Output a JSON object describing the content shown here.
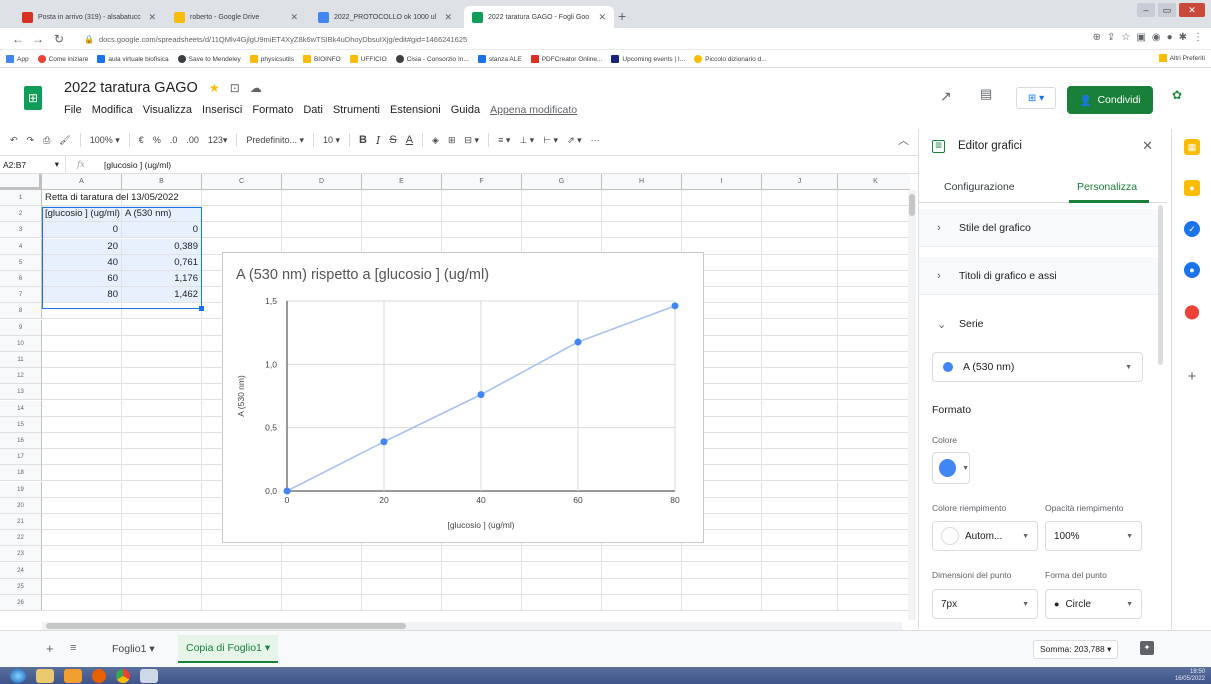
{
  "browser": {
    "tabs": [
      {
        "title": "Posta in arrivo (319) - alsabatucc",
        "color": "#d93025"
      },
      {
        "title": "roberto - Google Drive",
        "color": "#fbbc04"
      },
      {
        "title": "2022_PROTOCOLLO ok 1000 ul",
        "color": "#4285f4"
      },
      {
        "title": "2022 taratura GAGO - Fogli Goo",
        "color": "#0f9d58"
      }
    ],
    "url": "docs.google.com/spreadsheets/d/11QMlv4GjlgU9miET4XyZ8k6wTSIBk4uDhoyDbsuIXjg/edit#gid=1466241625",
    "bookmarks": [
      "App",
      "Come iniziare",
      "aula virtuale biofisica",
      "Save to Mendeley",
      "physicsutils",
      "BIOINFO",
      "UFFICIO",
      "Cisia - Consorzio In...",
      "stanza ALE",
      "PDFCreator Online...",
      "Upcoming events | I...",
      "Piccolo dizionario d..."
    ],
    "other_bookmarks": "Altri Preferiti"
  },
  "doc": {
    "title": "2022 taratura GAGO",
    "menus": [
      "File",
      "Modifica",
      "Visualizza",
      "Inserisci",
      "Formato",
      "Dati",
      "Strumenti",
      "Estensioni",
      "Guida"
    ],
    "saved_status": "Appena modificato",
    "share_label": "Condividi"
  },
  "toolbar": {
    "zoom": "100%",
    "currency": "€",
    "percent": "%",
    "dec_less": ".0",
    "dec_more": ".00",
    "format_more": "123",
    "font": "Predefinito...",
    "font_size": "10"
  },
  "formula_bar": {
    "name_box": "A2:B7",
    "fx": "fx",
    "content": "[glucosio ] (ug/ml)"
  },
  "grid": {
    "columns": [
      "A",
      "B",
      "C",
      "D",
      "E",
      "F",
      "G",
      "H",
      "I",
      "J",
      "K"
    ],
    "rows": [
      "1",
      "2",
      "3",
      "4",
      "5",
      "6",
      "7",
      "8",
      "9",
      "10",
      "11",
      "12",
      "13",
      "14",
      "15",
      "16",
      "17",
      "18",
      "19",
      "20",
      "21",
      "22",
      "23",
      "24",
      "25",
      "26"
    ],
    "cells": {
      "A1": "Retta di taratura del 13/05/2022",
      "A2": "[glucosio ] (ug/ml)",
      "B2": "A (530 nm)",
      "A3": "0",
      "B3": "0",
      "A4": "20",
      "B4": "0,389",
      "A5": "40",
      "B5": "0,761",
      "A6": "60",
      "B6": "1,176",
      "A7": "80",
      "B7": "1,462"
    }
  },
  "chart_data": {
    "type": "line",
    "title": "A (530 nm) rispetto a [glucosio ] (ug/ml)",
    "xlabel": "[glucosio ] (ug/ml)",
    "ylabel": "A (530 nm)",
    "x": [
      0,
      20,
      40,
      60,
      80
    ],
    "series": [
      {
        "name": "A (530 nm)",
        "values": [
          0,
          0.389,
          0.761,
          1.176,
          1.462
        ]
      }
    ],
    "xlim": [
      0,
      80
    ],
    "ylim": [
      0,
      1.5
    ],
    "x_ticks": [
      "0",
      "20",
      "40",
      "60",
      "80"
    ],
    "y_ticks": [
      "0,0",
      "0,5",
      "1,0",
      "1,5"
    ],
    "grid": true,
    "legend": "none",
    "color": "#4285f4"
  },
  "panel": {
    "title": "Editor grafici",
    "tabs": [
      "Configurazione",
      "Personalizza"
    ],
    "sections": [
      "Stile del grafico",
      "Titoli di grafico e assi",
      "Serie"
    ],
    "series_selected": "A (530 nm)",
    "format_heading": "Formato",
    "color_label": "Colore",
    "fill_color_label": "Colore riempimento",
    "fill_color_value": "Autom...",
    "fill_opacity_label": "Opacità riempimento",
    "fill_opacity_value": "100%",
    "point_size_label": "Dimensioni del punto",
    "point_size_value": "7px",
    "point_shape_label": "Forma del punto",
    "point_shape_value": "Circle"
  },
  "sheets": {
    "tabs": [
      "Foglio1",
      "Copia di Foglio1"
    ],
    "active": 1,
    "sum": "Somma: 203,788"
  },
  "taskbar": {
    "time": "18:50",
    "date": "16/05/2022"
  }
}
